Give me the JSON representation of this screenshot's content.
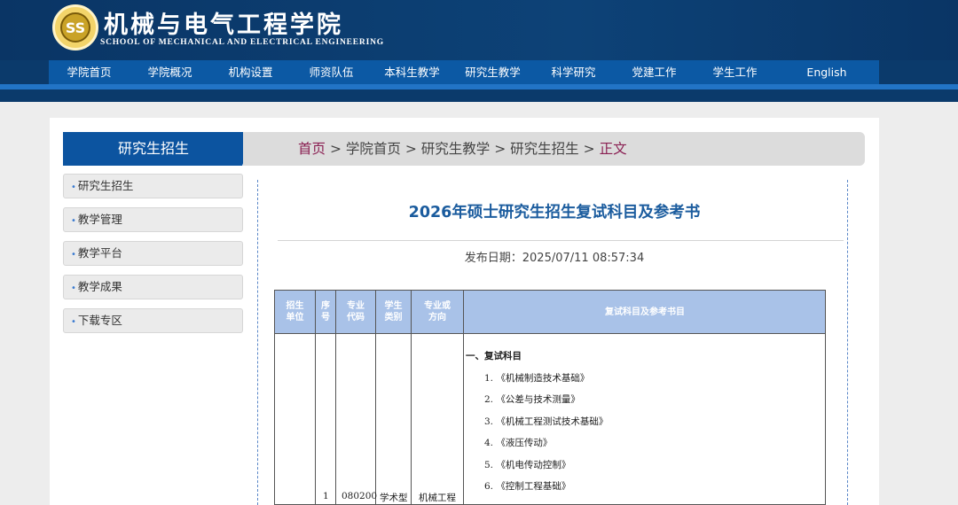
{
  "header": {
    "logo_mark": "SS",
    "title_cn": "机械与电气工程学院",
    "title_en": "SCHOOL OF MECHANICAL AND ELECTRICAL ENGINEERING"
  },
  "nav": {
    "items": [
      {
        "label": "学院首页"
      },
      {
        "label": "学院概况"
      },
      {
        "label": "机构设置"
      },
      {
        "label": "师资队伍"
      },
      {
        "label": "本科生教学"
      },
      {
        "label": "研究生教学"
      },
      {
        "label": "科学研究"
      },
      {
        "label": "党建工作"
      },
      {
        "label": "学生工作"
      },
      {
        "label": "English"
      }
    ]
  },
  "section": {
    "title": "研究生招生"
  },
  "breadcrumb": {
    "items": [
      "首页",
      "学院首页",
      "研究生教学",
      "研究生招生",
      "正文"
    ],
    "separator": ">"
  },
  "sidebar": {
    "bullet": "•",
    "items": [
      {
        "label": "研究生招生"
      },
      {
        "label": "教学管理"
      },
      {
        "label": "教学平台"
      },
      {
        "label": "教学成果"
      },
      {
        "label": "下载专区"
      }
    ]
  },
  "article": {
    "title": "2026年硕士研究生招生复试科目及参考书",
    "publish_date": "发布日期：2025/07/11 08:57:34"
  },
  "table": {
    "headers": [
      {
        "l1": "招生",
        "l2": "单位"
      },
      {
        "l1": "序",
        "l2": "号"
      },
      {
        "l1": "专业",
        "l2": "代码"
      },
      {
        "l1": "学生",
        "l2": "类别"
      },
      {
        "l1": "专业或",
        "l2": "方向"
      },
      {
        "l1": "复试科目及参考书目",
        "l2": ""
      }
    ],
    "row": {
      "index": "1",
      "code": "080200",
      "type": "学术型",
      "major": "机械工程"
    },
    "section_heading": "一、复试科目",
    "subjects": [
      "1. 《机械制造技术基础》",
      "2. 《公差与技术测量》",
      "3. 《机械工程测试技术基础》",
      "4. 《液压传动》",
      "5. 《机电传动控制》",
      "6. 《控制工程基础》"
    ]
  },
  "colors": {
    "header_bg": "#0b3a6b",
    "nav_bg": "#0c59a4",
    "accent_blue": "#1b5c9e",
    "breadcrumb_link": "#8a1f52",
    "table_header_bg": "#a9c2e8"
  }
}
